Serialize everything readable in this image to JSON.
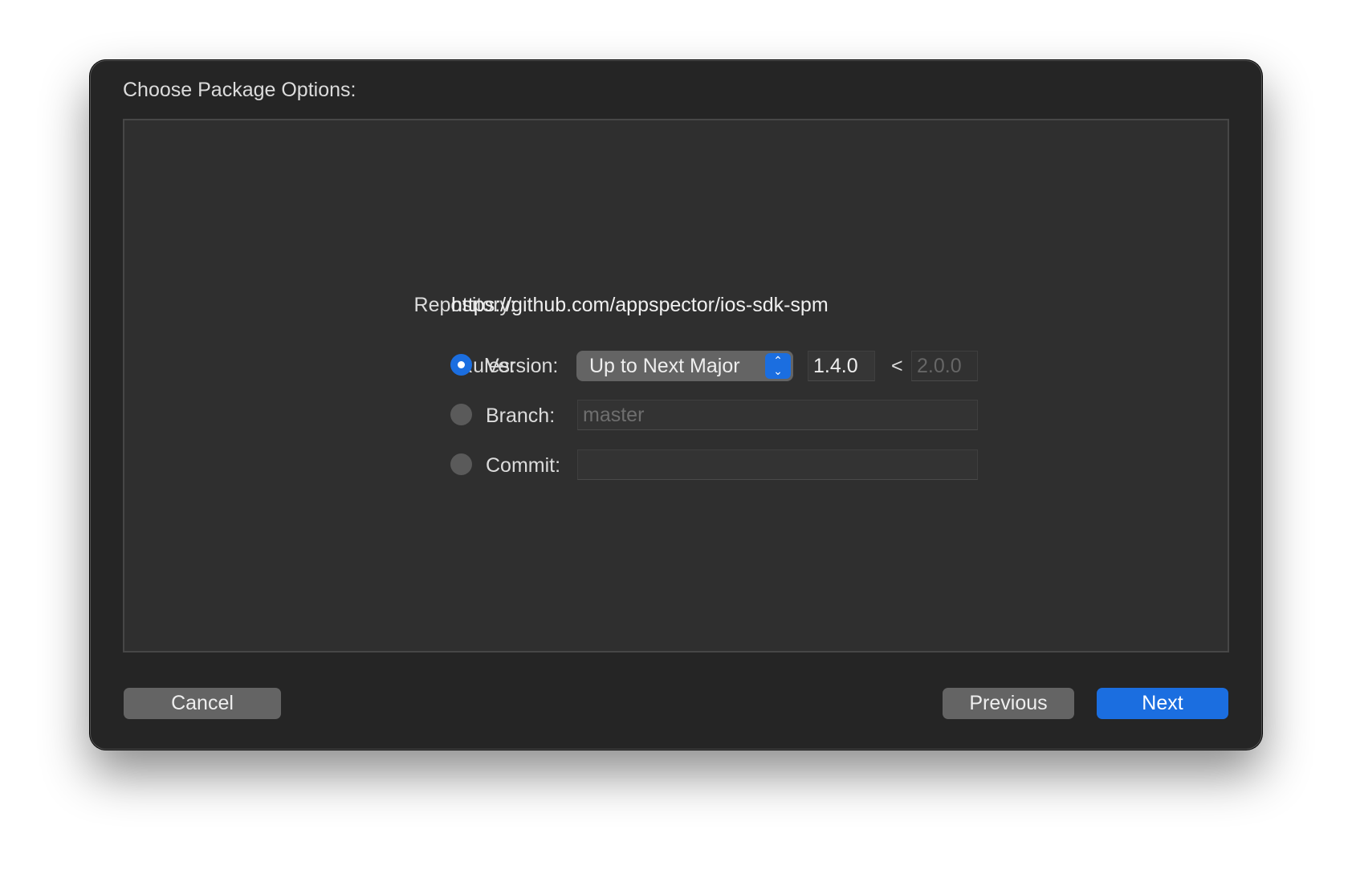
{
  "dialog": {
    "title": "Choose Package Options:",
    "repository": {
      "label": "Repository:",
      "value": "https://github.com/appspector/ios-sdk-spm"
    },
    "rules": {
      "label": "Rules:",
      "selected": "version",
      "version": {
        "label": "Version:",
        "rule": "Up to Next Major",
        "lower": "1.4.0",
        "separator": "<",
        "upper": "2.0.0"
      },
      "branch": {
        "label": "Branch:",
        "placeholder": "master"
      },
      "commit": {
        "label": "Commit:",
        "value": ""
      }
    },
    "buttons": {
      "cancel": "Cancel",
      "previous": "Previous",
      "next": "Next"
    },
    "accent": "#1b6ee0"
  }
}
